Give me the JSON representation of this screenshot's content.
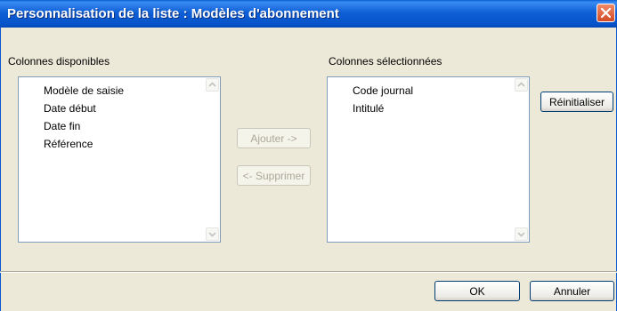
{
  "window": {
    "title": "Personnalisation de la liste : Modèles d'abonnement"
  },
  "available": {
    "label": "Colonnes disponibles",
    "items": [
      "Modèle de saisie",
      "Date début",
      "Date fin",
      "Référence"
    ]
  },
  "selected": {
    "label": "Colonnes sélectionnées",
    "items": [
      "Code journal",
      "Intitulé"
    ]
  },
  "buttons": {
    "add": "Ajouter ->",
    "remove": "<- Supprimer",
    "reset": "Réinitialiser",
    "ok": "OK",
    "cancel": "Annuler"
  },
  "icons": {
    "close": "close-icon",
    "scroll_up": "scroll-up-icon",
    "scroll_down": "scroll-down-icon"
  },
  "colors": {
    "titlebar": "#0A5FD7",
    "dialog_bg": "#ECE9D8",
    "close_button": "#D24A24"
  }
}
